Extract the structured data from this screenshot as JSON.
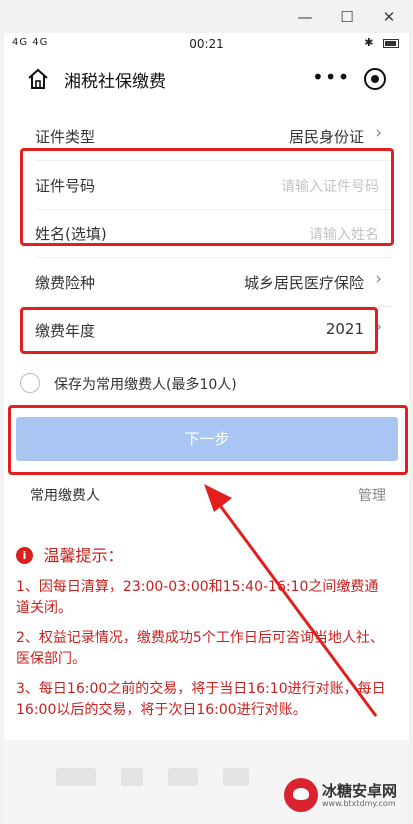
{
  "status_bar": {
    "signal": "4G 4G",
    "time": "00:21",
    "bluetooth": "✱"
  },
  "nav": {
    "title": "湘税社保缴费",
    "home_icon": "home-icon",
    "more_icon": "more-icon",
    "target_icon": "target-icon"
  },
  "form": {
    "id_type": {
      "label": "证件类型",
      "value": "居民身份证"
    },
    "id_number": {
      "label": "证件号码",
      "placeholder": "请输入证件号码"
    },
    "name": {
      "label": "姓名(选填)",
      "placeholder": "请输入姓名"
    },
    "insurance_type": {
      "label": "缴费险种",
      "value": "城乡居民医疗保险"
    },
    "year": {
      "label": "缴费年度",
      "value": "2021"
    },
    "save_checkbox_label": "保存为常用缴费人(最多10人)",
    "next_button": "下一步"
  },
  "favorites": {
    "title": "常用缴费人",
    "manage": "管理"
  },
  "tips": {
    "title": "温馨提示：",
    "items": [
      "1、因每日清算，23:00-03:00和15:40-16:10之间缴费通道关闭。",
      "2、权益记录情况，缴费成功5个工作日后可咨询当地人社、医保部门。",
      "3、每日16:00之前的交易，将于当日16:10进行对账，每日16:00以后的交易，将于次日16:00进行对账。"
    ]
  },
  "watermark": {
    "text": "冰糖安卓网",
    "url": "www.btxtdmy.com"
  },
  "colors": {
    "highlight": "#e21f1f",
    "button": "#a9c6f3",
    "tips": "#c8201e"
  }
}
